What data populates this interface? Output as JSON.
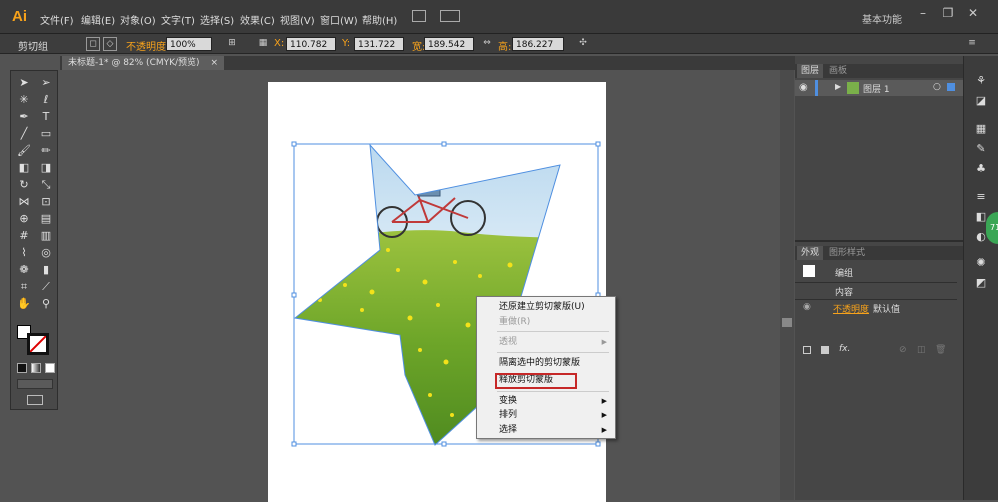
{
  "app": {
    "logo": "Ai"
  },
  "menu": [
    "文件(F)",
    "编辑(E)",
    "对象(O)",
    "文字(T)",
    "选择(S)",
    "效果(C)",
    "视图(V)",
    "窗口(W)",
    "帮助(H)"
  ],
  "workspace": "基本功能",
  "window_controls": {
    "minimize": "–",
    "restore": "❐",
    "close": "✕"
  },
  "control": {
    "selection_label": "剪切组",
    "opacity_label": "不透明度",
    "opacity_value": "100%",
    "x_label": "X:",
    "x_value": "110.782",
    "y_label": "Y:",
    "y_value": "131.722",
    "w_label": "宽:",
    "w_value": "189.542",
    "h_label": "高:",
    "h_value": "186.227"
  },
  "document_tab": {
    "title": "未标题-1* @ 82% (CMYK/预览)",
    "close": "×"
  },
  "layers_panel": {
    "tabs": [
      "图层",
      "画板"
    ],
    "layer_name": "图层 1"
  },
  "appearance_panel": {
    "tabs": [
      "外观",
      "图形样式"
    ],
    "object": "编组",
    "content": "内容",
    "opacity_label": "不透明度",
    "opacity_value": "默认值",
    "fx": "fx."
  },
  "context_menu": {
    "items": [
      {
        "label": "还原建立剪切蒙版(U)",
        "disabled": false,
        "submenu": false
      },
      {
        "label": "重做(R)",
        "disabled": true,
        "submenu": false
      },
      {
        "label": "透视",
        "disabled": true,
        "submenu": true
      },
      {
        "label": "隔离选中的剪切蒙版",
        "disabled": false,
        "submenu": false
      },
      {
        "label": "释放剪切蒙版",
        "disabled": false,
        "submenu": false
      },
      {
        "label": "变换",
        "disabled": false,
        "submenu": true
      },
      {
        "label": "排列",
        "disabled": false,
        "submenu": true
      },
      {
        "label": "选择",
        "disabled": false,
        "submenu": true
      }
    ]
  },
  "badge": {
    "text": "71"
  },
  "colors": {
    "accent": "#f7a21b",
    "highlight_box": "#c62828",
    "selection": "#4f8fe0"
  }
}
